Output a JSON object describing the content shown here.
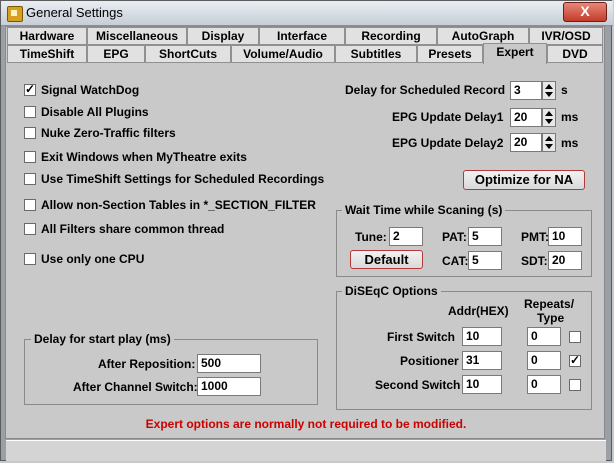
{
  "window": {
    "title": "General Settings",
    "close_label": "X"
  },
  "tabs_row1": [
    "Hardware",
    "Miscellaneous",
    "Display",
    "Interface",
    "Recording",
    "AutoGraph",
    "IVR/OSD"
  ],
  "tabs_row2": [
    "TimeShift",
    "EPG",
    "ShortCuts",
    "Volume/Audio",
    "Subtitles",
    "Presets",
    "Expert",
    "DVD"
  ],
  "active_tab": "Expert",
  "checkboxes": [
    {
      "label": "Signal WatchDog",
      "checked": true
    },
    {
      "label": "Disable All Plugins",
      "checked": false
    },
    {
      "label": "Nuke Zero-Traffic filters",
      "checked": false
    },
    {
      "label": "Exit Windows when MyTheatre exits",
      "checked": false
    },
    {
      "label": "Use TimeShift Settings for Scheduled Recordings",
      "checked": false
    },
    {
      "label": "Allow non-Section Tables in *_SECTION_FILTER",
      "checked": false
    },
    {
      "label": "All Filters share common thread",
      "checked": false
    },
    {
      "label": "Use only one CPU",
      "checked": false
    }
  ],
  "delays": {
    "scheduled_record_label": "Delay for Scheduled Record",
    "scheduled_record_value": "3",
    "scheduled_record_unit": "s",
    "epg1_label": "EPG Update Delay1",
    "epg1_value": "20",
    "epg1_unit": "ms",
    "epg2_label": "EPG Update Delay2",
    "epg2_value": "20",
    "epg2_unit": "ms"
  },
  "optimize_button": "Optimize for NA",
  "wait_time": {
    "title": "Wait Time while Scaning (s)",
    "tune_label": "Tune:",
    "tune_value": "2",
    "pat_label": "PAT:",
    "pat_value": "5",
    "pmt_label": "PMT:",
    "pmt_value": "10",
    "cat_label": "CAT:",
    "cat_value": "5",
    "sdt_label": "SDT:",
    "sdt_value": "20",
    "default_button": "Default"
  },
  "diseqc": {
    "title": "DiSEqC Options",
    "addr_header": "Addr(HEX)",
    "repeats_header_1": "Repeats/",
    "repeats_header_2": "Type",
    "rows": [
      {
        "label": "First Switch",
        "addr": "10",
        "repeats": "0",
        "checked": false
      },
      {
        "label": "Positioner",
        "addr": "31",
        "repeats": "0",
        "checked": true
      },
      {
        "label": "Second Switch",
        "addr": "10",
        "repeats": "0",
        "checked": false
      }
    ]
  },
  "start_play": {
    "title": "Delay for start play  (ms)",
    "reposition_label": "After Reposition:",
    "reposition_value": "500",
    "channel_switch_label": "After Channel Switch:",
    "channel_switch_value": "1000"
  },
  "warning": "Expert options are normally not required to be modified."
}
